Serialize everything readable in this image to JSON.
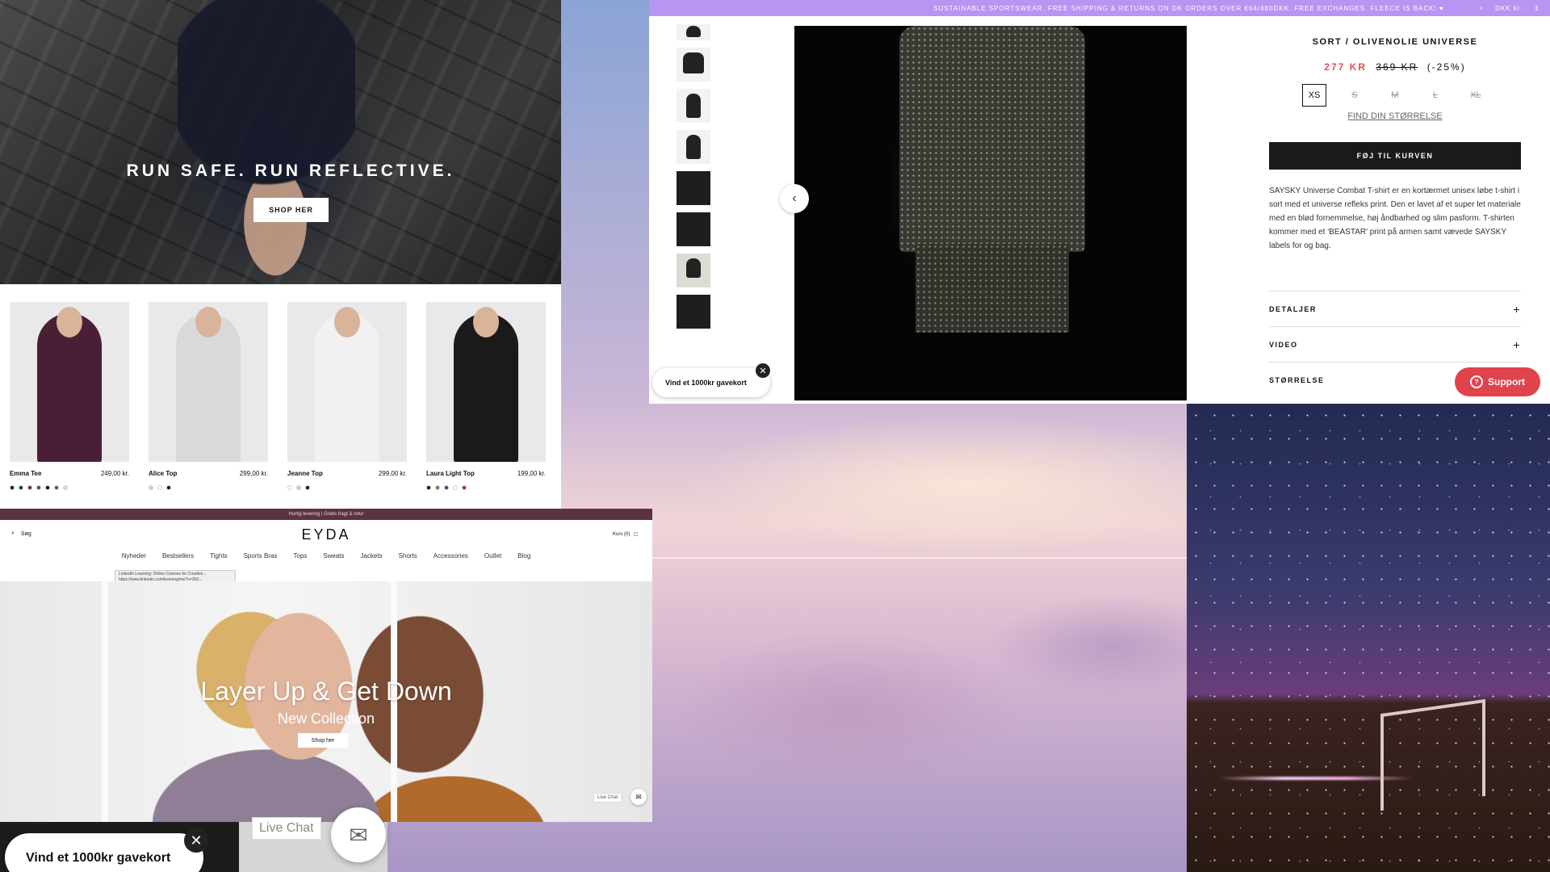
{
  "panel_run": {
    "headline": "RUN SAFE. RUN REFLECTIVE.",
    "cta": "SHOP HER"
  },
  "products": [
    {
      "name": "Emma Tee",
      "price": "249,00 kr.",
      "shirt_color": "#4a1f36",
      "swatches": [
        "#111111",
        "#2b2e4a",
        "#6b2736",
        "#37506e",
        "#0c0c0c",
        "#555555",
        "#e5d9c2"
      ]
    },
    {
      "name": "Alice Top",
      "price": "299,00 kr.",
      "shirt_color": "#d9d9d9",
      "swatches": [
        "#d0d0d0",
        "#ffffff",
        "#111111"
      ]
    },
    {
      "name": "Jeanne Top",
      "price": "299,00 kr.",
      "shirt_color": "#f1f1f1",
      "swatches": [
        "#ffffff",
        "#cccccc",
        "#111111"
      ]
    },
    {
      "name": "Laura Light Top",
      "price": "199,00 kr.",
      "shirt_color": "#1a1a1a",
      "swatches": [
        "#111111",
        "#7a7a6a",
        "#3b4a7a",
        "#ffffff",
        "#8e2b6a"
      ]
    }
  ],
  "sortsky": {
    "banner": "SUSTAINABLE SPORTSWEAR. FREE SHIPPING & RETURNS ON DK ORDERS OVER €64/480DKK. FREE EXCHANGES. FLEECE IS BACK! ♥",
    "currency": "DKK kr.",
    "variant_title": "SORT / OLIVENOLIE UNIVERSE",
    "price_now": "277 KR",
    "price_was": "369 KR",
    "discount": "(-25%)",
    "sizes": [
      "XS",
      "S",
      "M",
      "L",
      "XL"
    ],
    "selected_size": "XS",
    "find_size": "FIND DIN STØRRELSE",
    "add_to_cart": "FØJ TIL KURVEN",
    "description": "SAYSKY Universe Combat T-shirt er en kortærmet unisex løbe t-shirt i sort med et universe refleks print. Den er lavet af et super let materiale med en blød fornemmelse, høj åndbarhed og slim pasform. T-shirten kommer med et 'BEASTAR' print på armen samt vævede SAYSKY labels for og bag.",
    "accordions": [
      "DETALJER",
      "VIDEO",
      "STØRRELSE"
    ],
    "gift_card": "Vind et 1000kr gavekort",
    "support": "Support"
  },
  "eyda": {
    "topbar": "Hurtig levering | Gratis fragt & retur",
    "logo": "EYDA",
    "search_placeholder": "Søg",
    "cart": "Kurv (0)",
    "nav": [
      "Nyheder",
      "Bestsellers",
      "Tights",
      "Sports Bras",
      "Tops",
      "Sweats",
      "Jackets",
      "Shorts",
      "Accessories",
      "Outlet",
      "Blog"
    ],
    "tooltip_line1": "LinkedIn Learning: Online Courses for Creative...",
    "tooltip_line2": "https://www.linkedin.com/learning/me?u=369...",
    "hero_title": "Layer Up & Get Down",
    "hero_subtitle": "New Collection",
    "hero_cta": "Shop her",
    "live_chat": "Live Chat"
  },
  "bottom_overlay": {
    "gift_card": "Vind et 1000kr gavekort",
    "live_chat": "Live Chat"
  },
  "colors": {
    "banner_purple": "#b894f3",
    "price_red": "#e14f55",
    "support_red": "#e0434c",
    "eyda_topbar": "#5b3340"
  }
}
